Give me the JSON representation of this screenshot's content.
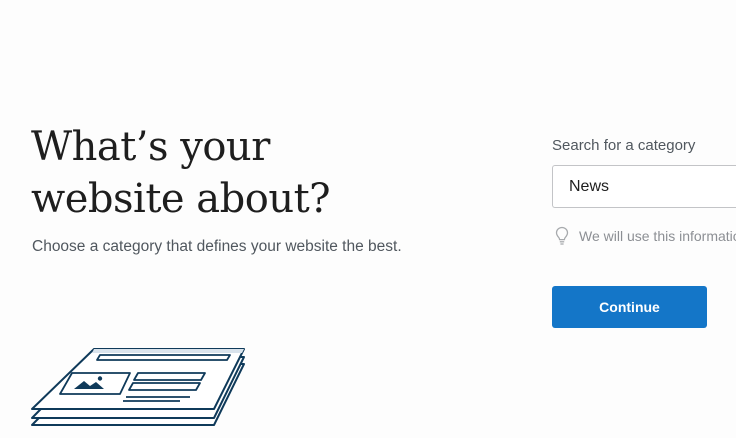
{
  "heading": {
    "line1": "What’s your",
    "line2": "website about?"
  },
  "subtitle": "Choose a category that defines your website the best.",
  "search": {
    "label": "Search for a category",
    "value": "News"
  },
  "hint": {
    "text": "We will use this information",
    "icon": "lightbulb-icon"
  },
  "continue_label": "Continue",
  "illustration": {
    "icon": "stacked-webpages-illustration",
    "stroke_color": "#0f3a5a"
  },
  "colors": {
    "accent": "#1476c8",
    "background": "#fdfdfd",
    "muted_text": "#50575e"
  }
}
